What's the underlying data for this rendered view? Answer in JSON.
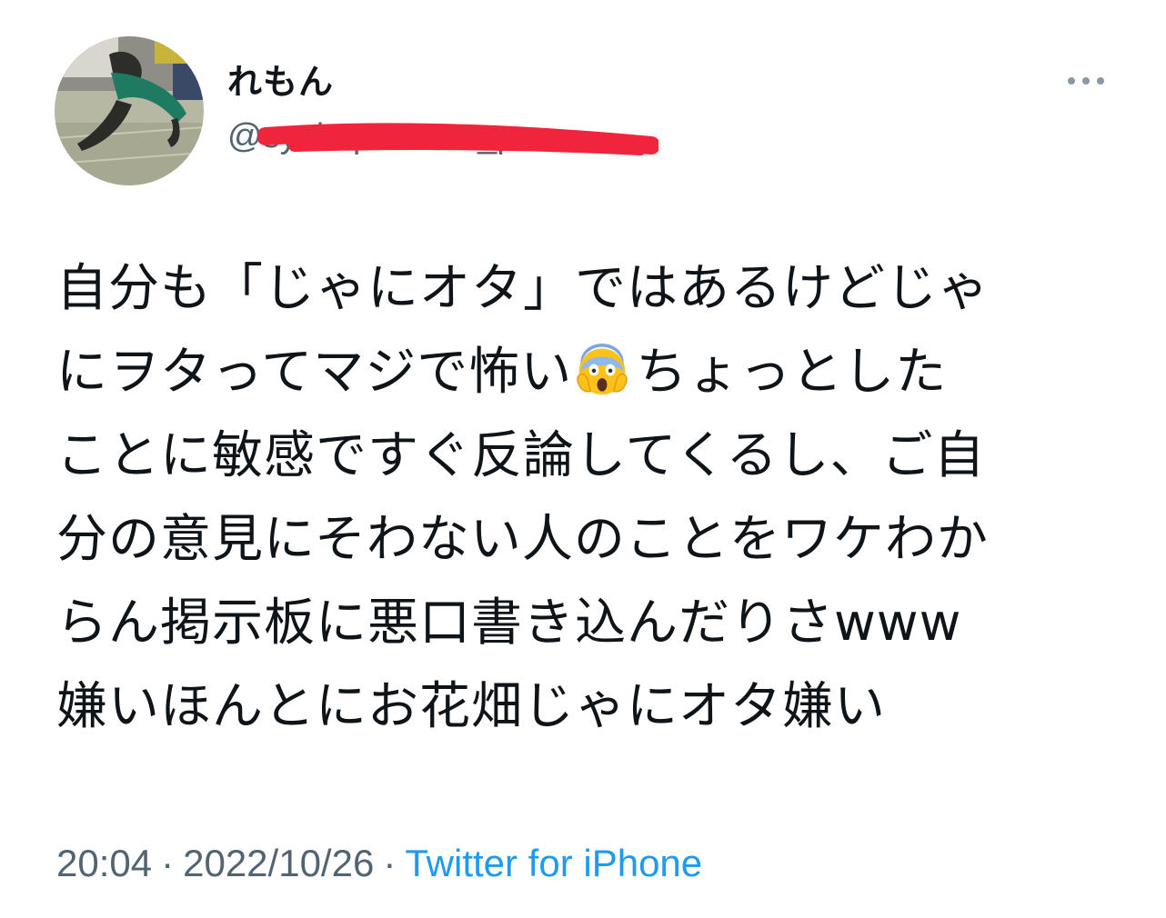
{
  "tweet": {
    "author": {
      "display_name": "れもん",
      "handle": "@syokupanman_p"
    },
    "text_lines": [
      "自分も「じゃにオタ」ではあるけどじゃ",
      "にヲタってマジで怖い",
      "ちょっとした",
      "ことに敏感ですぐ反論してくるし、ご自",
      "分の意見にそわない人のことをワケわか",
      "らん掲示板に悪口書き込んだりさwww",
      "嫌いほんとにお花畑じゃにオタ嫌い"
    ],
    "emoji": "screaming-face-emoji",
    "time": "20:04",
    "date": "2022/10/26",
    "separator": "·",
    "source": "Twitter for iPhone",
    "more_icon": "more-horizontal-icon"
  },
  "colors": {
    "text": "#0f1419",
    "secondary": "#536471",
    "link": "#1d9bf0",
    "redaction": "#f0243a"
  }
}
